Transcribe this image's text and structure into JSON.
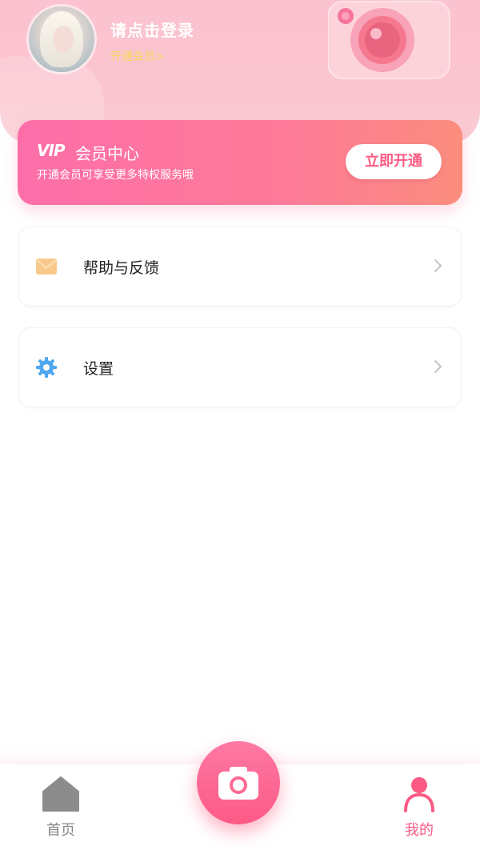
{
  "header": {
    "login_title": "请点击登录",
    "open_vip_link": "开通会员>"
  },
  "vip_card": {
    "badge": "VIP",
    "title": "会员中心",
    "description": "开通会员可享受更多特权服务哦",
    "button_label": "立即开通"
  },
  "menu": {
    "items": [
      {
        "label": "帮助与反馈",
        "icon": "envelope-icon"
      },
      {
        "label": "设置",
        "icon": "gear-icon"
      }
    ]
  },
  "bottom_nav": {
    "home_label": "首页",
    "home_icon": "home-icon",
    "camera_icon": "camera-icon",
    "mine_label": "我的",
    "mine_icon": "user-icon"
  },
  "colors": {
    "accent": "#fb5a84",
    "vip_gradient_start": "#fd6ea9",
    "vip_gradient_end": "#fb8d7d",
    "header_bg": "#fbc2cf",
    "vip_link": "#f6d95c",
    "nav_inactive": "#8a8a8a"
  }
}
